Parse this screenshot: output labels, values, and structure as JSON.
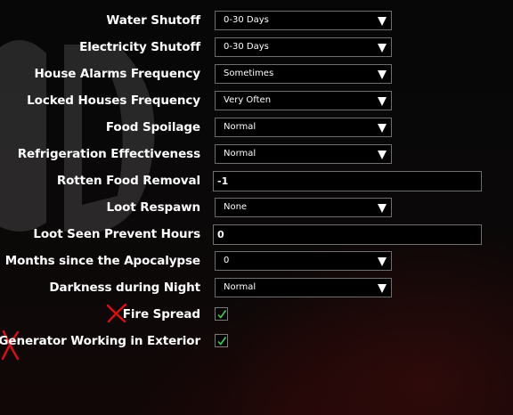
{
  "colors": {
    "text": "#ffffff",
    "field_bg": "#000000",
    "field_border": "#6e6e6e",
    "checkmark": "#3fd14a",
    "annotation_x": "#e01010"
  },
  "settings": [
    {
      "label": "Water Shutoff",
      "type": "select",
      "value": "0-30 Days"
    },
    {
      "label": "Electricity Shutoff",
      "type": "select",
      "value": "0-30 Days"
    },
    {
      "label": "House Alarms Frequency",
      "type": "select",
      "value": "Sometimes"
    },
    {
      "label": "Locked Houses Frequency",
      "type": "select",
      "value": "Very Often"
    },
    {
      "label": "Food Spoilage",
      "type": "select",
      "value": "Normal"
    },
    {
      "label": "Refrigeration Effectiveness",
      "type": "select",
      "value": "Normal"
    },
    {
      "label": "Rotten Food Removal",
      "type": "text",
      "value": "-1"
    },
    {
      "label": "Loot Respawn",
      "type": "select",
      "value": "None"
    },
    {
      "label": "Loot Seen Prevent Hours",
      "type": "text",
      "value": "0"
    },
    {
      "label": "Months since the Apocalypse",
      "type": "select",
      "value": "0"
    },
    {
      "label": "Darkness during Night",
      "type": "select",
      "value": "Normal"
    },
    {
      "label": "Fire Spread",
      "type": "checkbox",
      "checked": true,
      "annotation": "red-x-mark"
    },
    {
      "label": "Generator Working in Exterior",
      "type": "checkbox",
      "checked": true,
      "annotation": "red-x-mark"
    }
  ]
}
